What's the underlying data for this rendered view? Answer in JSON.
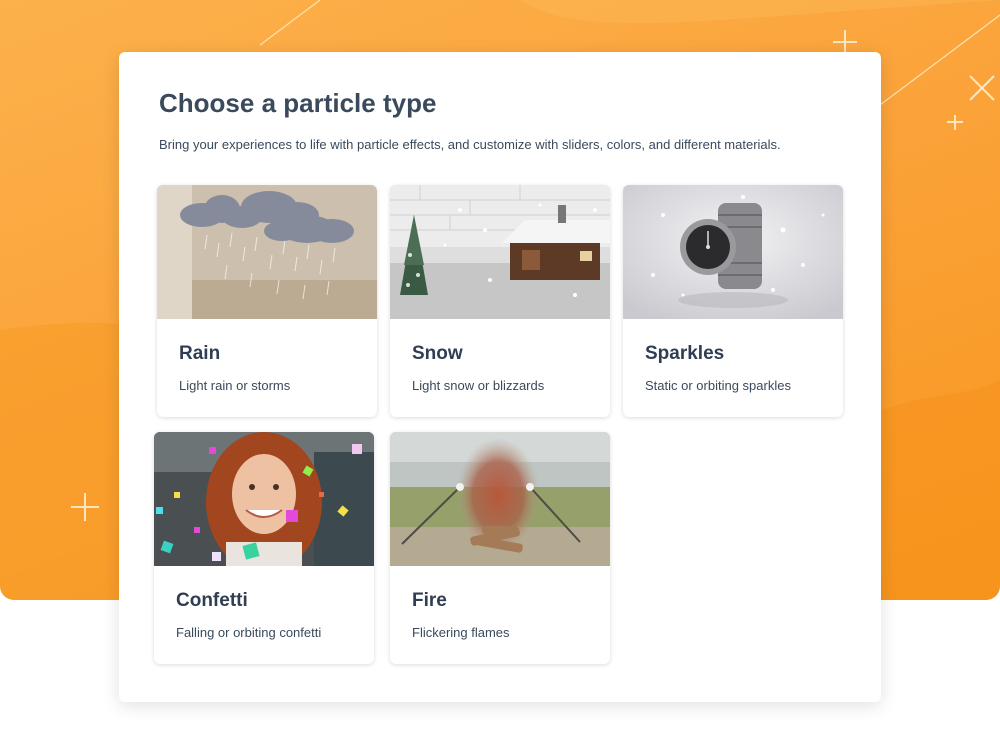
{
  "page": {
    "title": "Choose a particle type",
    "subtitle": "Bring your experiences to life with particle effects, and customize with sliders, colors, and different materials."
  },
  "particle_types": [
    {
      "name": "Rain",
      "description": "Light rain or storms",
      "icon": "rain-clouds-image"
    },
    {
      "name": "Snow",
      "description": "Light snow or blizzards",
      "icon": "snowy-cabin-image"
    },
    {
      "name": "Sparkles",
      "description": "Static or orbiting sparkles",
      "icon": "sparkling-watch-image"
    },
    {
      "name": "Confetti",
      "description": "Falling or orbiting confetti",
      "icon": "confetti-portrait-image"
    },
    {
      "name": "Fire",
      "description": "Flickering flames",
      "icon": "campfire-image"
    }
  ],
  "colors": {
    "background_accent": "#f9a530",
    "heading": "#3a4a5c",
    "card": "#ffffff"
  }
}
